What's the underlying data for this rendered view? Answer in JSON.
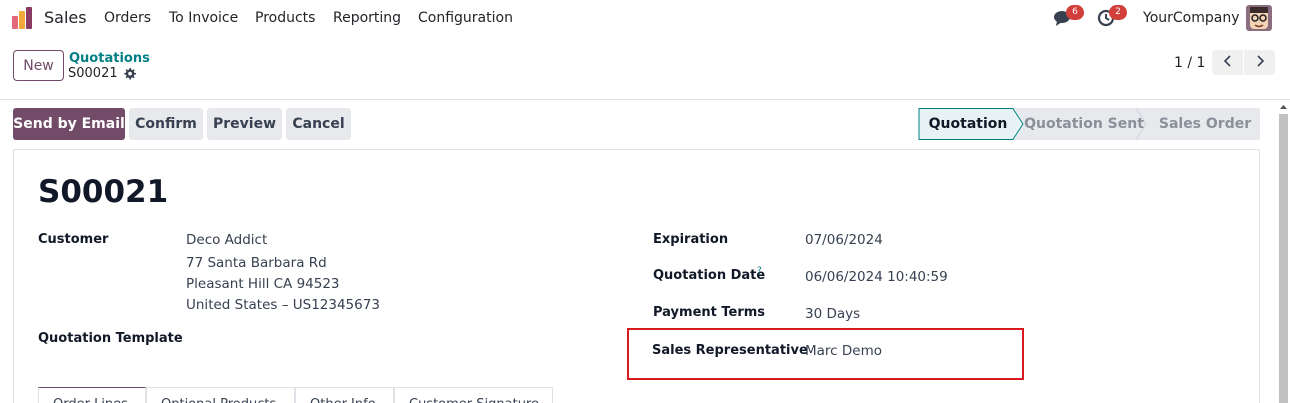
{
  "navbar": {
    "app_name": "Sales",
    "menu": [
      "Orders",
      "To Invoice",
      "Products",
      "Reporting",
      "Configuration"
    ],
    "messages_count": "6",
    "activities_count": "2",
    "company": "YourCompany",
    "icons": [
      "sales-app-icon",
      "chat-icon",
      "clock-icon",
      "avatar"
    ]
  },
  "control_panel": {
    "new_label": "New",
    "breadcrumb_parent": "Quotations",
    "breadcrumb_current": "S00021",
    "pager": "1 / 1"
  },
  "actions": {
    "send_email": "Send by Email",
    "confirm": "Confirm",
    "preview": "Preview",
    "cancel": "Cancel"
  },
  "stages": [
    "Quotation",
    "Quotation Sent",
    "Sales Order"
  ],
  "active_stage": "Quotation",
  "form": {
    "name": "S00021",
    "customer_label": "Customer",
    "customer_lines": [
      "Deco Addict",
      "77 Santa Barbara Rd",
      "Pleasant Hill CA 94523",
      "United States – US12345673"
    ],
    "template_label": "Quotation Template",
    "expiration_label": "Expiration",
    "expiration_value": "07/06/2024",
    "date_label": "Quotation Date",
    "date_help": "?",
    "date_value": "06/06/2024 10:40:59",
    "terms_label": "Payment Terms",
    "terms_value": "30 Days",
    "salesrep_label": "Sales Representative",
    "salesrep_value": "Marc Demo"
  },
  "tabs": [
    "Order Lines",
    "Optional Products",
    "Other Info",
    "Customer Signature"
  ],
  "colors": {
    "brand": "#714b67",
    "link": "#017e84",
    "badge": "#d23f3a",
    "highlight": "#d71920"
  }
}
